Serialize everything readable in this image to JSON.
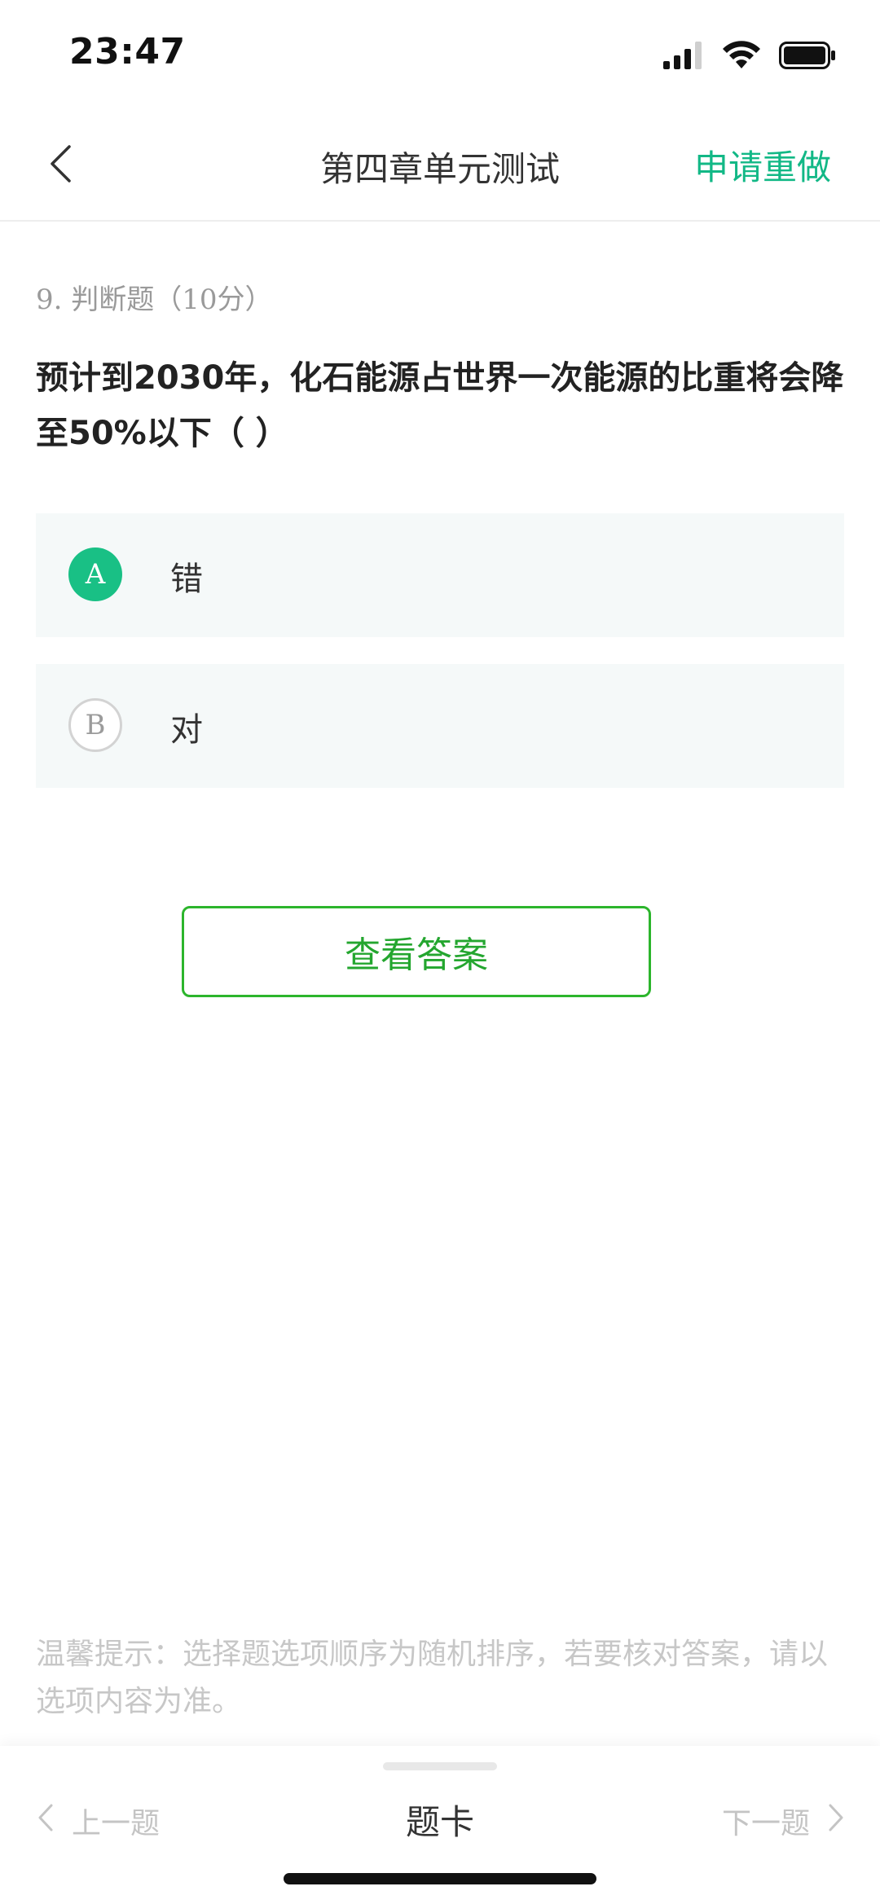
{
  "status_bar": {
    "time": "23:47",
    "icons": [
      "signal-icon",
      "wifi-icon",
      "battery-icon"
    ]
  },
  "header": {
    "back_icon": "chevron-left-icon",
    "title": "第四章单元测试",
    "action_label": "申请重做"
  },
  "question": {
    "number": "9.",
    "type": "判断题",
    "score": "（10分）",
    "text": "预计到2030年，化石能源占世界一次能源的比重将会降至50%以下（ ）",
    "options": [
      {
        "letter": "A",
        "text": "错",
        "selected": true
      },
      {
        "letter": "B",
        "text": "对",
        "selected": false
      }
    ]
  },
  "answer_button": {
    "label": "查看答案"
  },
  "tip": {
    "text": "温馨提示：选择题选项顺序为随机排序，若要核对答案，请以选项内容为准。"
  },
  "bottom_nav": {
    "prev_label": "上一题",
    "card_label": "题卡",
    "next_label": "下一题"
  },
  "colors": {
    "accent": "#12b886",
    "selected_badge": "#19c085",
    "answer_button": "#24a62f",
    "option_bg": "#f5f9f9",
    "muted_text": "#c4c4c4"
  }
}
